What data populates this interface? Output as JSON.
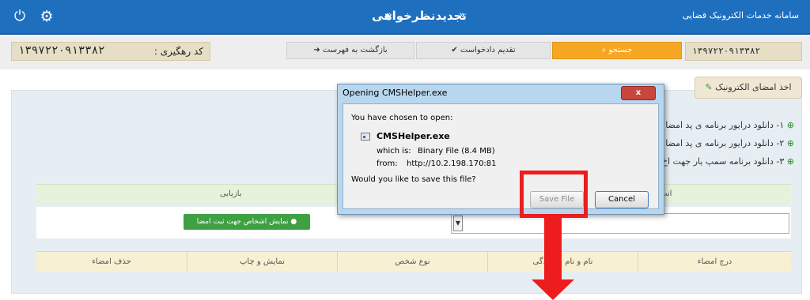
{
  "header": {
    "title": "تجدیدنظرخواهی",
    "title_prefix": "»",
    "title_suffix": "»",
    "brand": "سامانه خدمات الکترونیک قضایی"
  },
  "toolbar": {
    "tracking_label": "کد رهگیری :",
    "tracking_code": "۱۳۹۷۲۲۰۹۱۳۳۸۲",
    "back_button": "بازگشت به فهرست",
    "submit_button": "تقدیم دادخواست",
    "search_button": "جستجو",
    "search_code": "۱۳۹۷۲۲۰۹۱۳۳۸۲"
  },
  "sign_tab": {
    "label": "اخذ امضای الکترونیک"
  },
  "downloads": [
    {
      "num": "۱-",
      "text": "دانلود درایور برنامه ی پد امضا"
    },
    {
      "num": "۲-",
      "text": "دانلود درایور برنامه ی پد امضا"
    },
    {
      "num": "۳-",
      "text": "دانلود برنامه سمپ یار جهت اخ"
    }
  ],
  "green_row": {
    "left_label": "بازیابی",
    "right_label": "انت"
  },
  "show_persons_button": "نمایش اشخاص جهت ثبت امضا",
  "table_headers": [
    "حذف امضاء",
    "نمایش و چاپ",
    "نوع شخص",
    "نام و نام خانوادگی",
    "درج امضاء"
  ],
  "dialog": {
    "title": "Opening CMSHelper.exe",
    "close": "x",
    "intro": "You have chosen to open:",
    "filename": "CMSHelper.exe",
    "which_is_label": "which is:",
    "which_is_value": "Binary File (8.4 MB)",
    "from_label": "from:",
    "from_value": "http://10.2.198.170:81",
    "question": "Would you like to save this file?",
    "save_button": "Save File",
    "cancel_button": "Cancel"
  },
  "colors": {
    "header_blue": "#1f6fbf",
    "search_orange": "#f5a623",
    "accent_green": "#3ea043",
    "annotation_red": "#ee1c1c"
  }
}
